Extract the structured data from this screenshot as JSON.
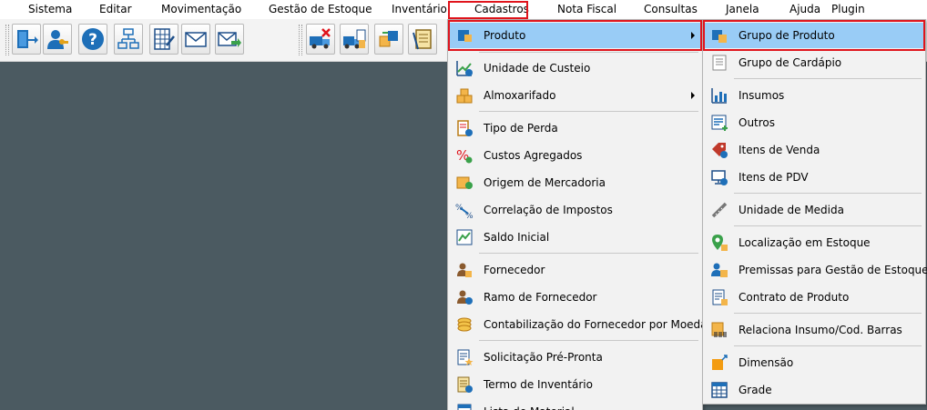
{
  "menubar": {
    "items": [
      "Sistema",
      "Editar",
      "Movimentação",
      "Gestão de Estoque",
      "Inventário",
      "Cadastros",
      "Nota Fiscal",
      "Consultas",
      "Janela",
      "Ajuda",
      "Plugin"
    ]
  },
  "toolbar": {
    "buttons": [
      "exit-icon",
      "user-key-icon",
      "help-icon",
      "org-chart-icon",
      "spreadsheet-icon",
      "envelope-icon",
      "envelope-send-icon",
      "truck-cancel-icon",
      "truck-document-icon",
      "transfer-box-icon",
      "clipboard-icon"
    ]
  },
  "cadastros_menu": {
    "items": [
      {
        "label": "Produto",
        "icon": "product-box-icon",
        "submenu": true,
        "selected": true
      },
      {
        "label": "Unidade de Custeio",
        "icon": "cost-chart-icon"
      },
      {
        "label": "Almoxarifado",
        "icon": "warehouse-boxes-icon",
        "submenu": true
      },
      {
        "label": "Tipo de Perda",
        "icon": "loss-clipboard-icon"
      },
      {
        "label": "Custos Agregados",
        "icon": "percent-icon"
      },
      {
        "label": "Origem de Mercadoria",
        "icon": "origin-box-icon"
      },
      {
        "label": "Correlação de Impostos",
        "icon": "tax-correlation-icon"
      },
      {
        "label": "Saldo Inicial",
        "icon": "balance-chart-icon"
      },
      {
        "label": "Fornecedor",
        "icon": "supplier-icon"
      },
      {
        "label": "Ramo de Fornecedor",
        "icon": "supplier-branch-icon"
      },
      {
        "label": "Contabilização do Fornecedor por Moeda",
        "icon": "coins-icon"
      },
      {
        "label": "Solicitação Pré-Pronta",
        "icon": "request-doc-icon"
      },
      {
        "label": "Termo de Inventário",
        "icon": "inventory-term-icon"
      },
      {
        "label": "Lista de Material",
        "icon": "material-list-icon"
      }
    ]
  },
  "produto_submenu": {
    "items": [
      {
        "label": "Grupo de Produto",
        "icon": "product-group-icon",
        "selected": true
      },
      {
        "label": "Grupo de Cardápio",
        "icon": "menu-group-icon"
      },
      {
        "label": "Insumos",
        "icon": "supplies-chart-icon"
      },
      {
        "label": "Outros",
        "icon": "others-list-icon"
      },
      {
        "label": "Itens de Venda",
        "icon": "sale-items-icon"
      },
      {
        "label": "Itens de PDV",
        "icon": "pos-monitor-icon"
      },
      {
        "label": "Unidade de Medida",
        "icon": "ruler-icon"
      },
      {
        "label": "Localização em Estoque",
        "icon": "location-pin-icon"
      },
      {
        "label": "Premissas para Gestão de Estoque",
        "icon": "stock-premises-icon"
      },
      {
        "label": "Contrato de Produto",
        "icon": "contract-doc-icon"
      },
      {
        "label": "Relaciona Insumo/Cod. Barras",
        "icon": "barcode-icon"
      },
      {
        "label": "Dimensão",
        "icon": "dimension-icon"
      },
      {
        "label": "Grade",
        "icon": "grid-icon"
      }
    ]
  },
  "colors": {
    "workspace": "#4b5a61",
    "selection": "#99ccf6",
    "highlight_border": "#e0141c"
  }
}
